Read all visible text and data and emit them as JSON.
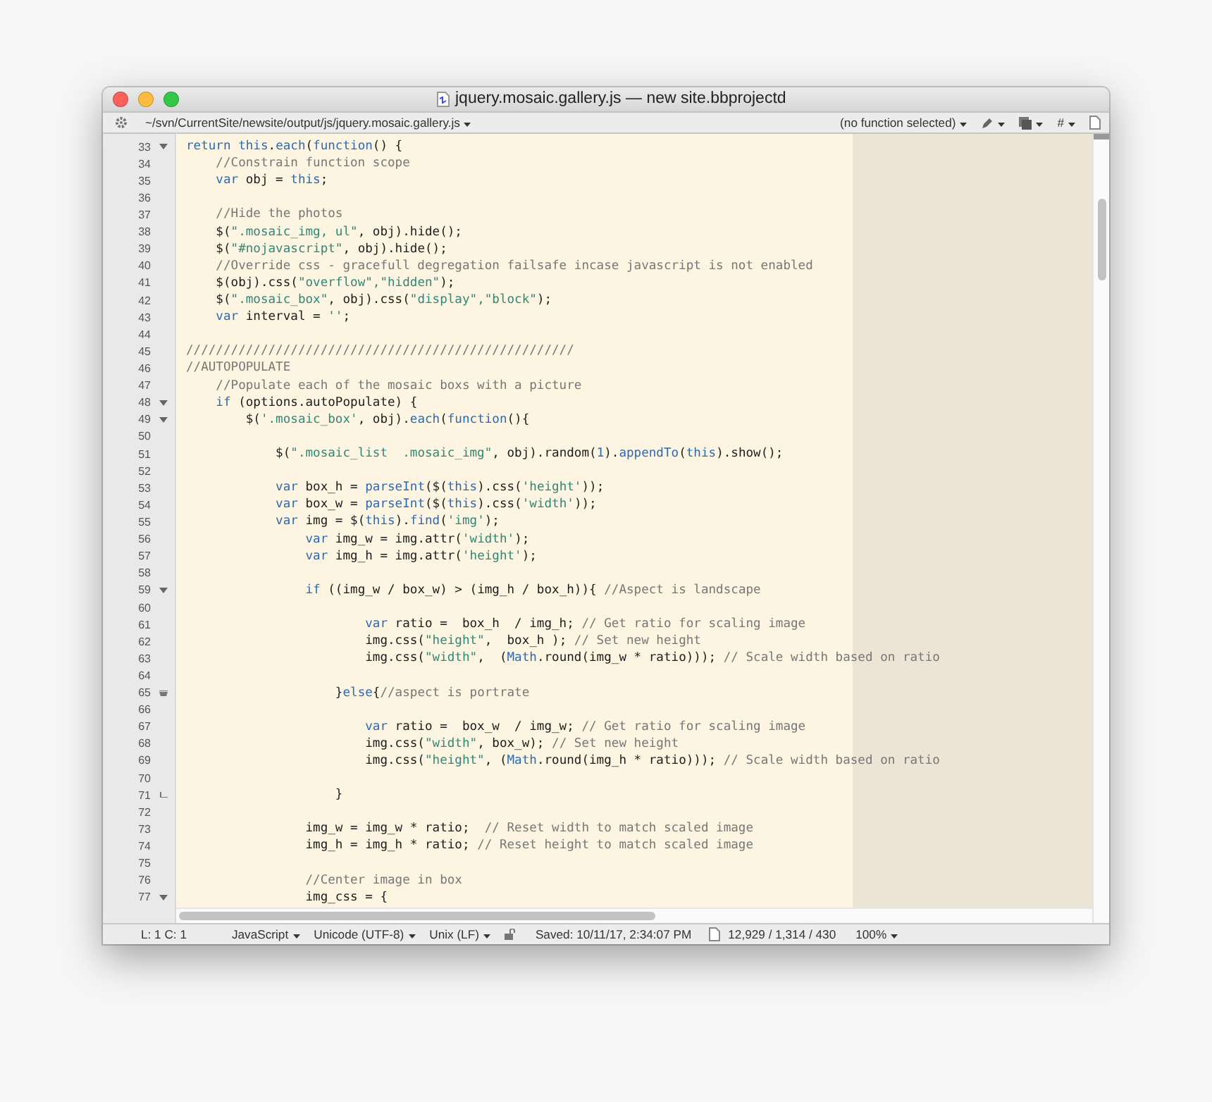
{
  "window": {
    "title": "jquery.mosaic.gallery.js — new site.bbprojectd"
  },
  "toolbar": {
    "path": "~/svn/CurrentSite/newsite/output/js/jquery.mosaic.gallery.js",
    "function_menu": "(no function selected)",
    "marker_menu": "#"
  },
  "editor": {
    "lines": [
      {
        "number": "33",
        "kind": "foldstart",
        "tokens": [
          {
            "kind": "keyword",
            "text": "return"
          },
          {
            "kind": "keyword",
            "text": " this"
          },
          {
            "kind": "plain",
            "text": "."
          },
          {
            "kind": "keyword",
            "text": "each"
          },
          {
            "kind": "plain",
            "text": "("
          },
          {
            "kind": "keyword",
            "text": "function"
          },
          {
            "kind": "plain",
            "text": "() {"
          }
        ]
      },
      {
        "number": "34",
        "kind": "plain",
        "tokens": [
          {
            "kind": "comment",
            "text": "    //Constrain function scope"
          }
        ]
      },
      {
        "number": "35",
        "kind": "plain",
        "tokens": [
          {
            "kind": "keyword",
            "text": "    var"
          },
          {
            "kind": "plain",
            "text": " obj = "
          },
          {
            "kind": "keyword",
            "text": "this"
          },
          {
            "kind": "plain",
            "text": ";"
          }
        ]
      },
      {
        "number": "36",
        "kind": "plain"
      },
      {
        "number": "37",
        "kind": "plain",
        "tokens": [
          {
            "kind": "comment",
            "text": "    //Hide the photos"
          }
        ]
      },
      {
        "number": "38",
        "kind": "plain",
        "tokens": [
          {
            "kind": "plain",
            "text": "    $("
          },
          {
            "kind": "string",
            "text": "\".mosaic_img, ul\""
          },
          {
            "kind": "plain",
            "text": ", obj).hide();"
          }
        ]
      },
      {
        "number": "39",
        "kind": "plain",
        "tokens": [
          {
            "kind": "plain",
            "text": "    $("
          },
          {
            "kind": "string",
            "text": "\"#nojavascript\""
          },
          {
            "kind": "plain",
            "text": ", obj).hide();"
          }
        ]
      },
      {
        "number": "40",
        "kind": "plain",
        "tokens": [
          {
            "kind": "comment",
            "text": "    //Override css - gracefull degregation failsafe incase javascript is not enabled"
          }
        ]
      },
      {
        "number": "41",
        "kind": "plain",
        "tokens": [
          {
            "kind": "plain",
            "text": "    $(obj).css("
          },
          {
            "kind": "string",
            "text": "\"overflow\",\"hidden\""
          },
          {
            "kind": "plain",
            "text": ");"
          }
        ]
      },
      {
        "number": "42",
        "kind": "plain",
        "tokens": [
          {
            "kind": "plain",
            "text": "    $("
          },
          {
            "kind": "string",
            "text": "\".mosaic_box\""
          },
          {
            "kind": "plain",
            "text": ", obj).css("
          },
          {
            "kind": "string",
            "text": "\"display\",\"block\""
          },
          {
            "kind": "plain",
            "text": ");"
          }
        ]
      },
      {
        "number": "43",
        "kind": "plain",
        "tokens": [
          {
            "kind": "keyword",
            "text": "    var"
          },
          {
            "kind": "plain",
            "text": " interval = "
          },
          {
            "kind": "string",
            "text": "''"
          },
          {
            "kind": "plain",
            "text": ";"
          }
        ]
      },
      {
        "number": "44",
        "kind": "plain"
      },
      {
        "number": "45",
        "kind": "plain",
        "tokens": [
          {
            "kind": "comment",
            "text": "////////////////////////////////////////////////////"
          }
        ]
      },
      {
        "number": "46",
        "kind": "plain",
        "tokens": [
          {
            "kind": "comment",
            "text": "//AUTOPOPULATE"
          }
        ]
      },
      {
        "number": "47",
        "kind": "plain",
        "tokens": [
          {
            "kind": "comment",
            "text": "    //Populate each of the mosaic boxs with a picture"
          }
        ]
      },
      {
        "number": "48",
        "kind": "foldstart",
        "tokens": [
          {
            "kind": "keyword",
            "text": "    if"
          },
          {
            "kind": "plain",
            "text": " (options.autoPopulate) {"
          }
        ]
      },
      {
        "number": "49",
        "kind": "foldstart",
        "tokens": [
          {
            "kind": "plain",
            "text": "        $("
          },
          {
            "kind": "string",
            "text": "'.mosaic_box'"
          },
          {
            "kind": "plain",
            "text": ", obj)."
          },
          {
            "kind": "keyword",
            "text": "each"
          },
          {
            "kind": "plain",
            "text": "("
          },
          {
            "kind": "keyword",
            "text": "function"
          },
          {
            "kind": "plain",
            "text": "(){"
          }
        ]
      },
      {
        "number": "50",
        "kind": "plain"
      },
      {
        "number": "51",
        "kind": "plain",
        "tokens": [
          {
            "kind": "plain",
            "text": "            $("
          },
          {
            "kind": "string",
            "text": "\".mosaic_list  .mosaic_img\""
          },
          {
            "kind": "plain",
            "text": ", obj).random("
          },
          {
            "kind": "keyword",
            "text": "1"
          },
          {
            "kind": "plain",
            "text": ")."
          },
          {
            "kind": "keyword",
            "text": "appendTo"
          },
          {
            "kind": "plain",
            "text": "("
          },
          {
            "kind": "keyword",
            "text": "this"
          },
          {
            "kind": "plain",
            "text": ").show();"
          }
        ]
      },
      {
        "number": "52",
        "kind": "plain"
      },
      {
        "number": "53",
        "kind": "plain",
        "tokens": [
          {
            "kind": "keyword",
            "text": "            var"
          },
          {
            "kind": "plain",
            "text": " box_h = "
          },
          {
            "kind": "keyword",
            "text": "parseInt"
          },
          {
            "kind": "plain",
            "text": "($("
          },
          {
            "kind": "keyword",
            "text": "this"
          },
          {
            "kind": "plain",
            "text": ").css("
          },
          {
            "kind": "string",
            "text": "'height'"
          },
          {
            "kind": "plain",
            "text": "));"
          }
        ]
      },
      {
        "number": "54",
        "kind": "plain",
        "tokens": [
          {
            "kind": "keyword",
            "text": "            var"
          },
          {
            "kind": "plain",
            "text": " box_w = "
          },
          {
            "kind": "keyword",
            "text": "parseInt"
          },
          {
            "kind": "plain",
            "text": "($("
          },
          {
            "kind": "keyword",
            "text": "this"
          },
          {
            "kind": "plain",
            "text": ").css("
          },
          {
            "kind": "string",
            "text": "'width'"
          },
          {
            "kind": "plain",
            "text": "));"
          }
        ]
      },
      {
        "number": "55",
        "kind": "plain",
        "tokens": [
          {
            "kind": "keyword",
            "text": "            var"
          },
          {
            "kind": "plain",
            "text": " img = $("
          },
          {
            "kind": "keyword",
            "text": "this"
          },
          {
            "kind": "plain",
            "text": ")."
          },
          {
            "kind": "keyword",
            "text": "find"
          },
          {
            "kind": "plain",
            "text": "("
          },
          {
            "kind": "string",
            "text": "'img'"
          },
          {
            "kind": "plain",
            "text": ");"
          }
        ]
      },
      {
        "number": "56",
        "kind": "plain",
        "tokens": [
          {
            "kind": "keyword",
            "text": "                var"
          },
          {
            "kind": "plain",
            "text": " img_w = img.attr("
          },
          {
            "kind": "string",
            "text": "'width'"
          },
          {
            "kind": "plain",
            "text": ");"
          }
        ]
      },
      {
        "number": "57",
        "kind": "plain",
        "tokens": [
          {
            "kind": "keyword",
            "text": "                var"
          },
          {
            "kind": "plain",
            "text": " img_h = img.attr("
          },
          {
            "kind": "string",
            "text": "'height'"
          },
          {
            "kind": "plain",
            "text": ");"
          }
        ]
      },
      {
        "number": "58",
        "kind": "plain"
      },
      {
        "number": "59",
        "kind": "foldstart",
        "tokens": [
          {
            "kind": "keyword",
            "text": "                if"
          },
          {
            "kind": "plain",
            "text": " ((img_w / box_w) > (img_h / box_h)){ "
          },
          {
            "kind": "comment",
            "text": "//Aspect is landscape"
          }
        ]
      },
      {
        "number": "60",
        "kind": "plain"
      },
      {
        "number": "61",
        "kind": "plain",
        "tokens": [
          {
            "kind": "keyword",
            "text": "                        var"
          },
          {
            "kind": "plain",
            "text": " ratio =  box_h  / img_h; "
          },
          {
            "kind": "comment",
            "text": "// Get ratio for scaling image"
          }
        ]
      },
      {
        "number": "62",
        "kind": "plain",
        "tokens": [
          {
            "kind": "plain",
            "text": "                        img.css("
          },
          {
            "kind": "string",
            "text": "\"height\""
          },
          {
            "kind": "plain",
            "text": ",  box_h ); "
          },
          {
            "kind": "comment",
            "text": "// Set new height"
          }
        ]
      },
      {
        "number": "63",
        "kind": "plain",
        "tokens": [
          {
            "kind": "plain",
            "text": "                        img.css("
          },
          {
            "kind": "string",
            "text": "\"width\""
          },
          {
            "kind": "plain",
            "text": ",  ("
          },
          {
            "kind": "keyword",
            "text": "Math"
          },
          {
            "kind": "plain",
            "text": ".round(img_w * ratio))); "
          },
          {
            "kind": "comment",
            "text": "// Scale width based on ratio"
          }
        ]
      },
      {
        "number": "64",
        "kind": "plain"
      },
      {
        "number": "65",
        "kind": "foldmiddle",
        "tokens": [
          {
            "kind": "plain",
            "text": "                    }"
          },
          {
            "kind": "keyword",
            "text": "else"
          },
          {
            "kind": "plain",
            "text": "{"
          },
          {
            "kind": "comment",
            "text": "//aspect is portrate"
          }
        ]
      },
      {
        "number": "66",
        "kind": "plain"
      },
      {
        "number": "67",
        "kind": "plain",
        "tokens": [
          {
            "kind": "keyword",
            "text": "                        var"
          },
          {
            "kind": "plain",
            "text": " ratio =  box_w  / img_w; "
          },
          {
            "kind": "comment",
            "text": "// Get ratio for scaling image"
          }
        ]
      },
      {
        "number": "68",
        "kind": "plain",
        "tokens": [
          {
            "kind": "plain",
            "text": "                        img.css("
          },
          {
            "kind": "string",
            "text": "\"width\""
          },
          {
            "kind": "plain",
            "text": ", box_w); "
          },
          {
            "kind": "comment",
            "text": "// Set new height"
          }
        ]
      },
      {
        "number": "69",
        "kind": "plain",
        "tokens": [
          {
            "kind": "plain",
            "text": "                        img.css("
          },
          {
            "kind": "string",
            "text": "\"height\""
          },
          {
            "kind": "plain",
            "text": ", ("
          },
          {
            "kind": "keyword",
            "text": "Math"
          },
          {
            "kind": "plain",
            "text": ".round(img_h * ratio))); "
          },
          {
            "kind": "comment",
            "text": "// Scale width based on ratio"
          }
        ]
      },
      {
        "number": "70",
        "kind": "plain"
      },
      {
        "number": "71",
        "kind": "foldend",
        "tokens": [
          {
            "kind": "plain",
            "text": "                    }"
          }
        ]
      },
      {
        "number": "72",
        "kind": "plain"
      },
      {
        "number": "73",
        "kind": "plain",
        "tokens": [
          {
            "kind": "plain",
            "text": "                img_w = img_w * ratio;  "
          },
          {
            "kind": "comment",
            "text": "// Reset width to match scaled image"
          }
        ]
      },
      {
        "number": "74",
        "kind": "plain",
        "tokens": [
          {
            "kind": "plain",
            "text": "                img_h = img_h * ratio; "
          },
          {
            "kind": "comment",
            "text": "// Reset height to match scaled image"
          }
        ]
      },
      {
        "number": "75",
        "kind": "plain"
      },
      {
        "number": "76",
        "kind": "plain",
        "tokens": [
          {
            "kind": "comment",
            "text": "                //Center image in box"
          }
        ]
      },
      {
        "number": "77",
        "kind": "foldstart",
        "tokens": [
          {
            "kind": "plain",
            "text": "                img_css = {"
          }
        ]
      }
    ]
  },
  "status_bar": {
    "position": "L: 1 C: 1",
    "language": "JavaScript",
    "encoding": "Unicode (UTF-8)",
    "line_endings": "Unix (LF)",
    "saved": "Saved: 10/11/17, 2:34:07 PM",
    "counts": "12,929 / 1,314 / 430",
    "zoom": "100%"
  }
}
